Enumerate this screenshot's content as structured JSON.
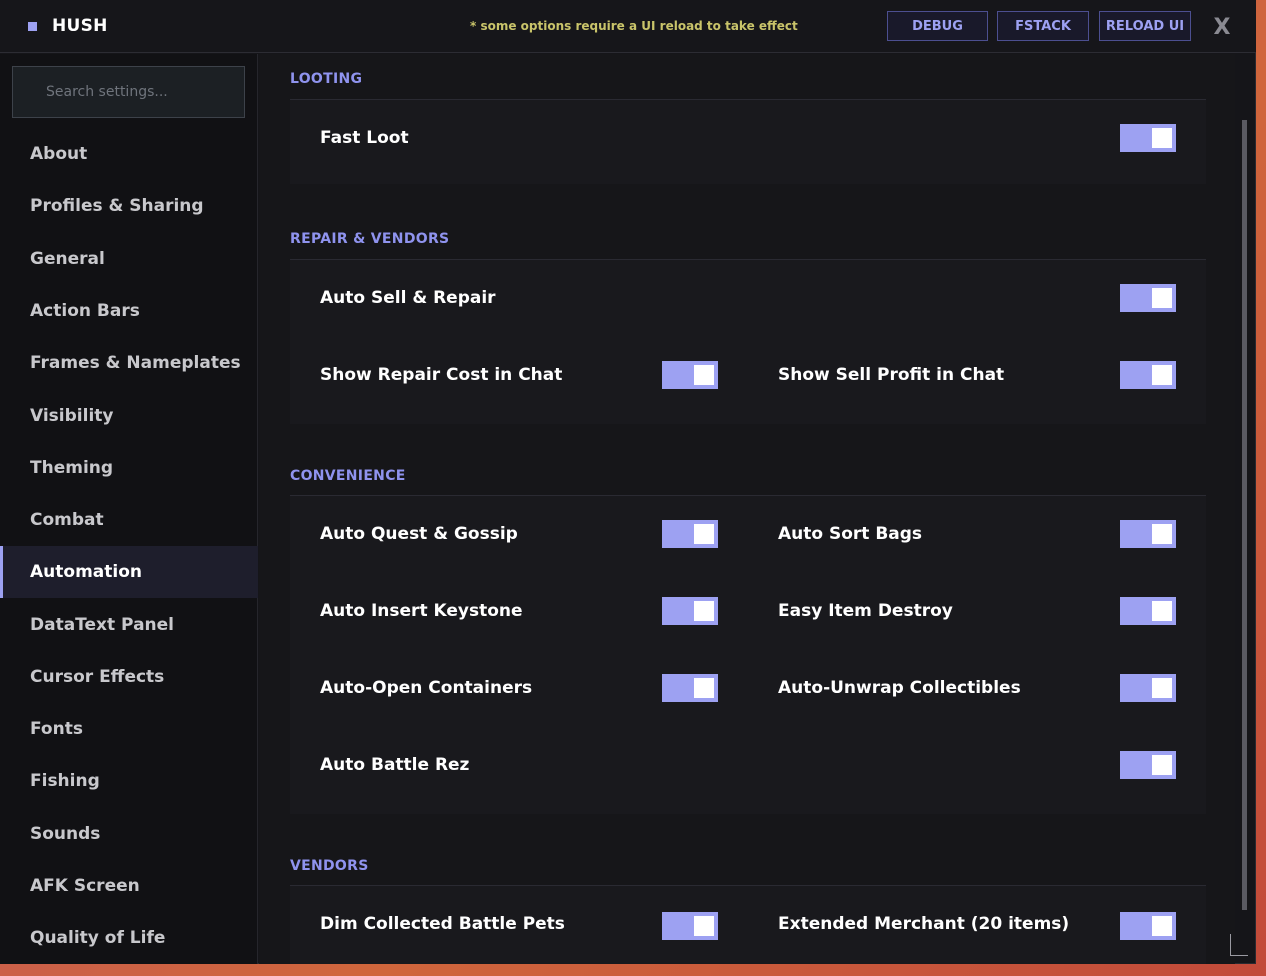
{
  "app": {
    "title": "HUSH"
  },
  "header": {
    "note": "* some options require a UI reload to take effect",
    "debug_label": "DEBUG",
    "fstack_label": "FSTACK",
    "reload_label": "RELOAD UI",
    "close_label": "X"
  },
  "search": {
    "placeholder": "Search settings..."
  },
  "sidebar": {
    "active": "Automation",
    "items": [
      "About",
      "Profiles & Sharing",
      "General",
      "Action Bars",
      "Frames & Nameplates",
      "Visibility",
      "Theming",
      "Combat",
      "Automation",
      "DataText Panel",
      "Cursor Effects",
      "Fonts",
      "Fishing",
      "Sounds",
      "AFK Screen",
      "Quality of Life"
    ]
  },
  "sections": {
    "looting": {
      "title": "LOOTING",
      "options": [
        {
          "label": "Fast Loot",
          "enabled": true
        }
      ]
    },
    "repair": {
      "title": "REPAIR & VENDORS",
      "options": [
        {
          "label": "Auto Sell & Repair",
          "enabled": true
        },
        {
          "label": "Show Repair Cost in Chat",
          "enabled": true
        },
        {
          "label": "Show Sell Profit in Chat",
          "enabled": true
        }
      ]
    },
    "convenience": {
      "title": "CONVENIENCE",
      "options": [
        {
          "label": "Auto Quest & Gossip",
          "enabled": true
        },
        {
          "label": "Auto Sort Bags",
          "enabled": true
        },
        {
          "label": "Auto Insert Keystone",
          "enabled": true
        },
        {
          "label": "Easy Item Destroy",
          "enabled": true
        },
        {
          "label": "Auto-Open Containers",
          "enabled": true
        },
        {
          "label": "Auto-Unwrap Collectibles",
          "enabled": true
        },
        {
          "label": "Auto Battle Rez",
          "enabled": true
        }
      ]
    },
    "vendors": {
      "title": "VENDORS",
      "options": [
        {
          "label": "Dim Collected Battle Pets",
          "enabled": true
        },
        {
          "label": "Extended Merchant (20 items)",
          "enabled": true
        }
      ]
    }
  },
  "colors": {
    "accent": "#9da1f2",
    "note": "#c9c46a",
    "bg": "#151519"
  }
}
